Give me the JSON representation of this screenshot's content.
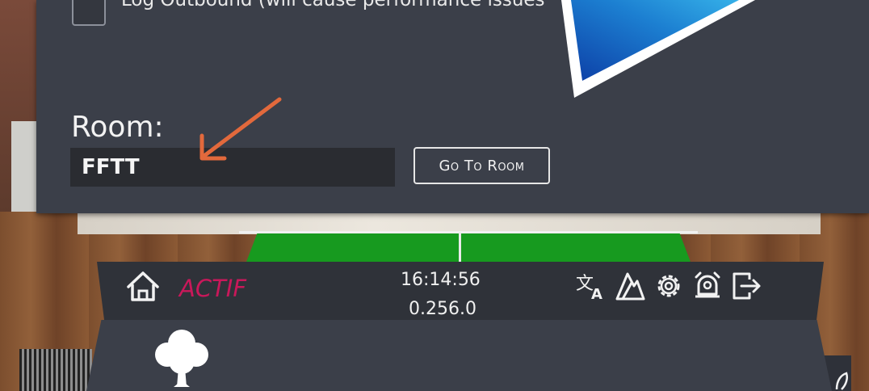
{
  "settings": {
    "log_outbound_label": "Log Outbound (will cause performance issues",
    "room_label": "Room:",
    "room_value": "FFTT",
    "go_to_room_label": "Go To Room"
  },
  "menu_bar": {
    "status": "ACTIF",
    "time": "16:14:56",
    "version": "0.256.0",
    "icons": [
      "home-icon",
      "translate-icon",
      "terrain-icon",
      "gear-icon",
      "alarm-bell-icon",
      "exit-icon"
    ]
  },
  "colors": {
    "panel": "#3b3f49",
    "status_accent": "#c9185a",
    "arrow": "#e2693c",
    "triangle": "#1a7fd0"
  }
}
